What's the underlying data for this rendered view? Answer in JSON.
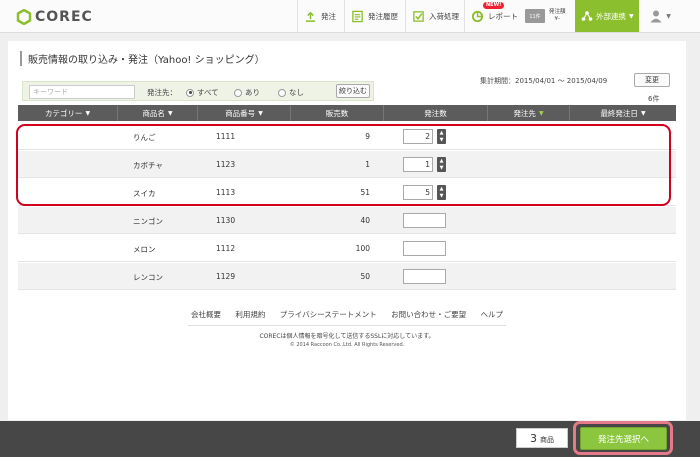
{
  "header": {
    "logo": "COREC",
    "nav": [
      {
        "label": "発注",
        "icon": "order-icon"
      },
      {
        "label": "発注履歴",
        "icon": "history-icon"
      },
      {
        "label": "入荷処理",
        "icon": "checkbox-icon"
      },
      {
        "label": "レポート",
        "icon": "report-icon",
        "badge": "NEW!"
      }
    ],
    "order_mini": {
      "icon_text": "11件",
      "label_top": "発注額",
      "label_bottom": "¥-"
    },
    "external_link": "外部連携",
    "accent_color": "#8cbf2d"
  },
  "page": {
    "title": "販売情報の取り込み・発注（Yahoo! ショッピング）",
    "keyword_placeholder": "キーワード",
    "destination_label": "発注先：",
    "radio_options": [
      {
        "label": "すべて",
        "selected": true
      },
      {
        "label": "あり",
        "selected": false
      },
      {
        "label": "なし",
        "selected": false
      }
    ],
    "narrow_button": "絞り込む",
    "period": "集計期間：2015/04/01 ～ 2015/04/09",
    "change_button": "変更",
    "count": "6件"
  },
  "table": {
    "columns": [
      "カテゴリー",
      "商品名",
      "商品番号",
      "販売数",
      "発注数",
      "発注先",
      "最終発注日"
    ],
    "rows": [
      {
        "name": "りんご",
        "code": "1111",
        "sold": "9",
        "qty": "2"
      },
      {
        "name": "カボチャ",
        "code": "1123",
        "sold": "1",
        "qty": "1"
      },
      {
        "name": "スイカ",
        "code": "1113",
        "sold": "51",
        "qty": "5"
      },
      {
        "name": "ニンゴン",
        "code": "1130",
        "sold": "40",
        "qty": ""
      },
      {
        "name": "メロン",
        "code": "1112",
        "sold": "100",
        "qty": ""
      },
      {
        "name": "レンコン",
        "code": "1129",
        "sold": "50",
        "qty": ""
      }
    ]
  },
  "footer": {
    "links": [
      "会社概要",
      "利用規約",
      "プライバシーステートメント",
      "お問い合わせ・ご要望",
      "ヘルプ"
    ],
    "note": "CORECは個人情報を暗号化して送信するSSLに対応しています。",
    "copyright": "© 2014 Raccoon Co.,Ltd. All Rights Reserved."
  },
  "bottom": {
    "selected_count": "3",
    "selected_unit": "商品",
    "next_button": "発注先選択へ"
  }
}
